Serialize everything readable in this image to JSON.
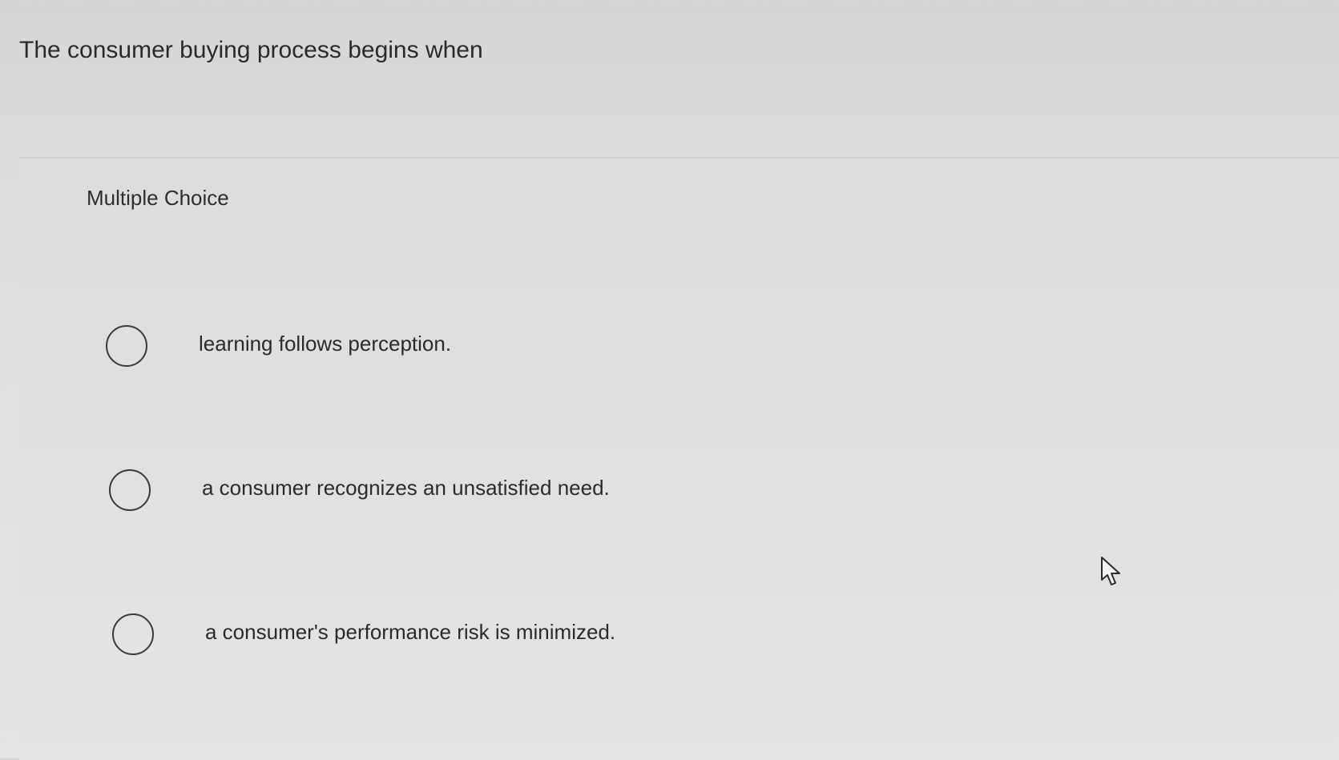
{
  "question": {
    "text": "The consumer buying process begins when"
  },
  "answer_section": {
    "type_label": "Multiple Choice",
    "options": [
      {
        "label": "learning follows perception."
      },
      {
        "label": "a consumer recognizes an unsatisfied need."
      },
      {
        "label": "a consumer's performance risk is minimized."
      }
    ]
  },
  "icons": {
    "radio": "radio-unselected-icon",
    "cursor": "mouse-pointer-icon"
  }
}
